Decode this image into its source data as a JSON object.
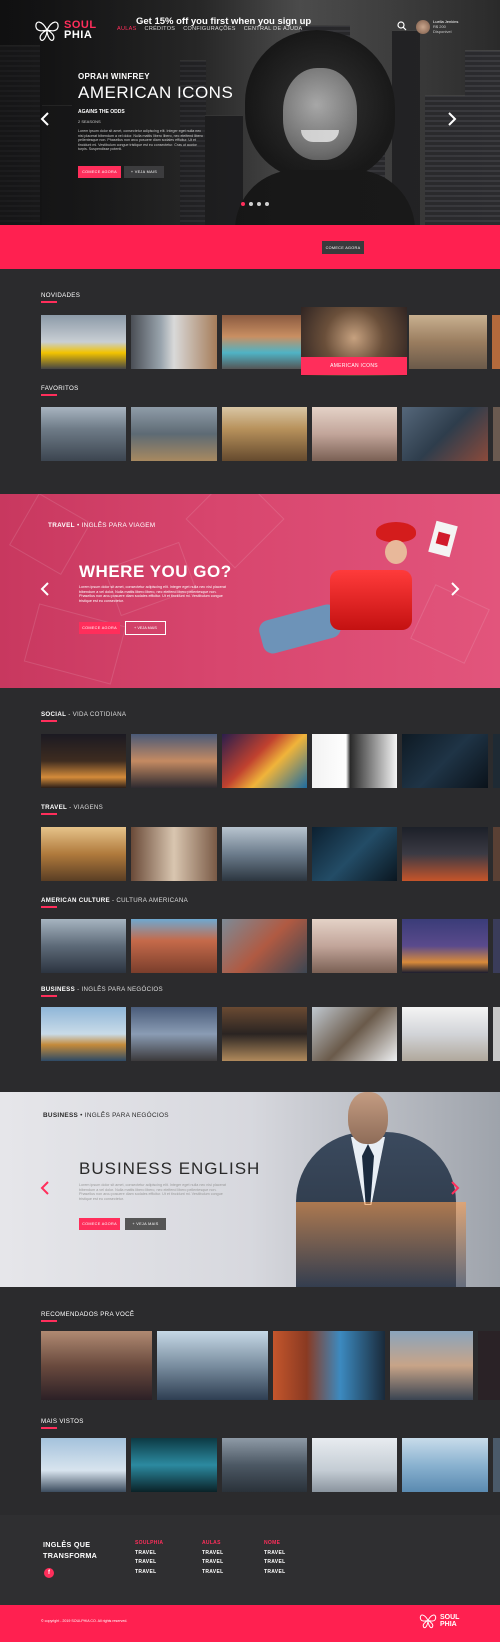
{
  "brand": {
    "line1": "SOUL",
    "line2": "PHIA"
  },
  "nav": {
    "items": [
      "AULAS",
      "CRÉDITOS",
      "CONFIGURAÇÕES",
      "CENTRAL DE AJUDA"
    ]
  },
  "user": {
    "name": "Luella Jenkins",
    "plan": "R$ 200",
    "status": "Disponivel"
  },
  "hero": {
    "subtitle": "OPRAH WINFREY",
    "title": "AMERICAN ICONS",
    "tagline": "AGAINS THE ODDS",
    "seasons": "2 SEASONS",
    "description": "Lorem ipsum dolor sit amet, consectetur adipiscing elit. Integer eget nulla nec nisi placerat bibendum a vel dolor. Nulla mattis libero libero, nec eleifend libero pellentesque non. Phasellus non arcu posuere diam sodales efficitur. Ut et tincidunt mi. Vestibulum congue tristique est eu consectetur. Cras ut auctor turpis. Suspendisse potenti.",
    "btn_primary": "COMECE AGORA",
    "btn_secondary": "+ VEJA MAIS",
    "slide_index": 1,
    "slide_count": 4
  },
  "promo": {
    "text": "Get 15% off you first when you sign up",
    "button": "COMECE AGORA"
  },
  "sections": {
    "novidades": {
      "title": "NOVIDADES",
      "featured_label": "AMERICAN ICONS"
    },
    "favoritos": {
      "title": "FAVORITOS"
    },
    "social": {
      "bold": "SOCIAL",
      "rest": " - VIDA COTIDIANA"
    },
    "travel": {
      "bold": "TRAVEL",
      "rest": " - VIAGENS"
    },
    "culture": {
      "bold": "AMERICAN CULTURE",
      "rest": " - CULTURA AMERICANA"
    },
    "business": {
      "bold": "BUSINESS",
      "rest": " - INGLÊS PARA NEGÓCIOS"
    },
    "recomendados": {
      "title": "RECOMENDADOS PRA VOCÊ"
    },
    "mais_vistos": {
      "title": "MAIS VISTOS"
    }
  },
  "travel_banner": {
    "category_bold": "TRAVEL",
    "category_rest": " • INGLÊS PARA VIAGEM",
    "title": "WHERE YOU GO?",
    "description": "Lorem ipsum dolor sit amet, consectetur adipiscing elit. Integer eget nulla nec nisi placerat bibendum a vel dolor. Nulla mattis libero libero, nec eleifend libero pellentesque non. Phasellus non arcu posuere diam sodales efficitur. Ut et tincidunt mi. Vestibulum congue tristique est eu consectetur.",
    "btn_primary": "COMECE AGORA",
    "btn_secondary": "+ VEJA MAIS"
  },
  "business_banner": {
    "category_bold": "BUSINESS",
    "category_rest": " • INGLÊS PARA NEGÓCIOS",
    "title": "BUSINESS ENGLISH",
    "description": "Lorem ipsum dolor sit amet, consectetur adipiscing elit. Integer eget nulla nec nisi placerat bibendum a vel dolor. Nulla mattis libero libero, nec eleifend libero pellentesque non. Phasellus non arcu posuere diam sodales efficitur. Ut et tincidunt mi. Vestibulum congue tristique est eu consectetur.",
    "btn_primary": "COMECE AGORA",
    "btn_secondary": "+ VEJA MAIS"
  },
  "footer": {
    "brand_line1": "INGLÊS QUE",
    "brand_line2": "TRANSFORMA",
    "fb": "f",
    "columns": [
      {
        "heading": "SOULPHIA",
        "items": [
          "TRAVEL",
          "TRAVEL",
          "TRAVEL"
        ]
      },
      {
        "heading": "AULAS",
        "items": [
          "TRAVEL",
          "TRAVEL",
          "TRAVEL"
        ]
      },
      {
        "heading": "NOME",
        "items": [
          "TRAVEL",
          "TRAVEL",
          "TRAVEL"
        ]
      }
    ],
    "copyright": "© copyright - 2019 SOULPHIA CO. All rights reserved."
  },
  "colors": {
    "accent": "#ff2050",
    "background": "#2b2b2d"
  },
  "icons": {
    "search": "search-icon",
    "left": "chevron-left-icon",
    "right": "chevron-right-icon",
    "logo": "butterfly-icon"
  }
}
